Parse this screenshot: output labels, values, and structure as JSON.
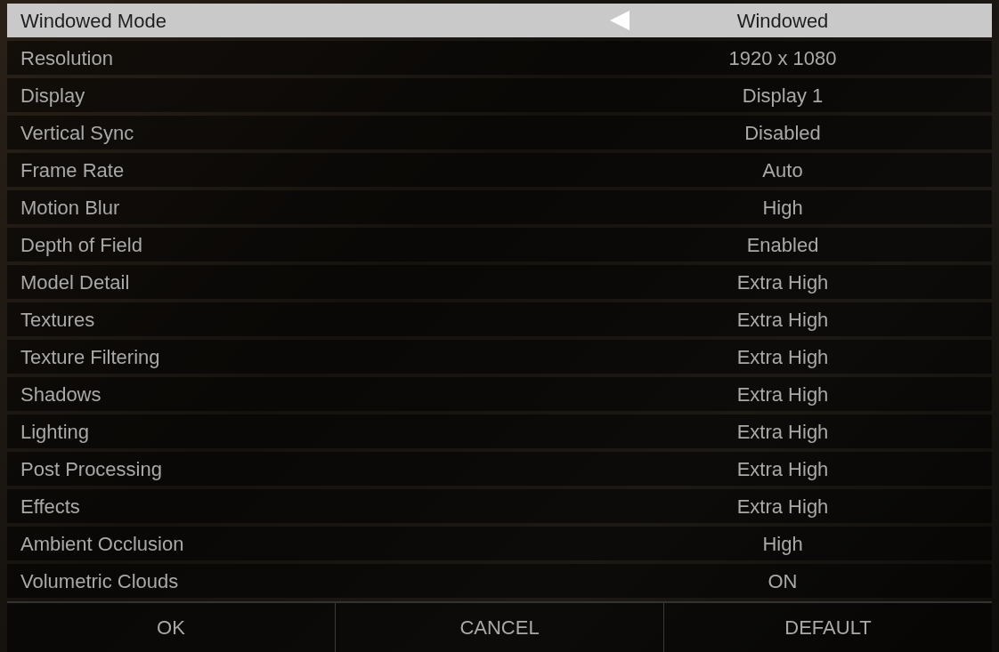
{
  "settings": [
    {
      "label": "Windowed Mode",
      "value": "Windowed",
      "selected": true
    },
    {
      "label": "Resolution",
      "value": "1920 x 1080",
      "selected": false
    },
    {
      "label": "Display",
      "value": "Display 1",
      "selected": false
    },
    {
      "label": "Vertical Sync",
      "value": "Disabled",
      "selected": false
    },
    {
      "label": "Frame Rate",
      "value": "Auto",
      "selected": false
    },
    {
      "label": "Motion Blur",
      "value": "High",
      "selected": false
    },
    {
      "label": "Depth of Field",
      "value": "Enabled",
      "selected": false
    },
    {
      "label": "Model Detail",
      "value": "Extra High",
      "selected": false
    },
    {
      "label": "Textures",
      "value": "Extra High",
      "selected": false
    },
    {
      "label": "Texture Filtering",
      "value": "Extra High",
      "selected": false
    },
    {
      "label": "Shadows",
      "value": "Extra High",
      "selected": false
    },
    {
      "label": "Lighting",
      "value": "Extra High",
      "selected": false
    },
    {
      "label": "Post Processing",
      "value": "Extra High",
      "selected": false
    },
    {
      "label": "Effects",
      "value": "Extra High",
      "selected": false
    },
    {
      "label": "Ambient Occlusion",
      "value": "High",
      "selected": false
    },
    {
      "label": "Volumetric Clouds",
      "value": "ON",
      "selected": false
    }
  ],
  "buttons": [
    "OK",
    "CANCEL",
    "DEFAULT"
  ]
}
